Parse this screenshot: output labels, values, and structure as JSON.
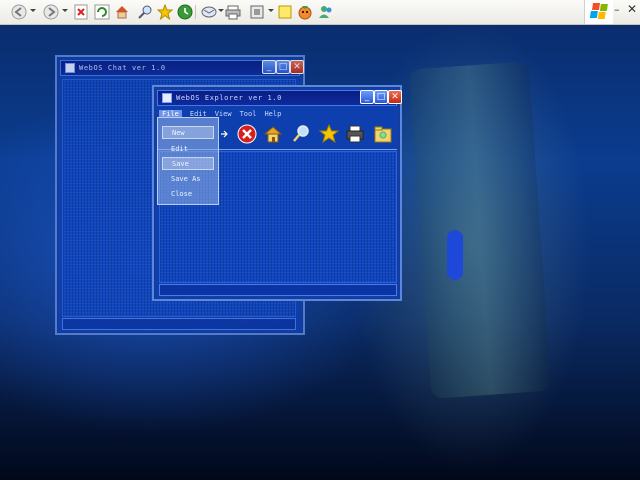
{
  "browser": {
    "toolbar_icons": [
      "back-icon",
      "forward-icon",
      "stop-icon",
      "refresh-icon",
      "home-icon",
      "search-icon",
      "favorites-icon",
      "history-icon",
      "mail-icon",
      "print-icon",
      "edit-icon",
      "notes-icon",
      "messenger-icon",
      "messenger-user-icon"
    ],
    "minimize_label": "–",
    "close_label": "✕"
  },
  "chat_window": {
    "title": "WebOS Chat ver 1.0",
    "buttons": {
      "minimize": "_",
      "maximize": "□",
      "close": "✕"
    }
  },
  "explorer_window": {
    "title": "WebOS Explorer ver 1.0",
    "buttons": {
      "minimize": "_",
      "maximize": "□",
      "close": "✕"
    },
    "menu": [
      "File",
      "Edit",
      "View",
      "Tool",
      "Help"
    ],
    "toolbar_icons": [
      "arrow-icon",
      "stop-icon",
      "home-icon",
      "search-icon",
      "favorite-star-icon",
      "printer-icon",
      "folder-icon"
    ]
  },
  "file_menu": {
    "items": [
      "New",
      "Edit",
      "Save",
      "Save As",
      "Close"
    ],
    "highlighted": [
      "New",
      "Save"
    ]
  },
  "colors": {
    "window_blue": "#0f46c4",
    "titlebar": "#0d2a9d",
    "close_red": "#c22a10"
  }
}
